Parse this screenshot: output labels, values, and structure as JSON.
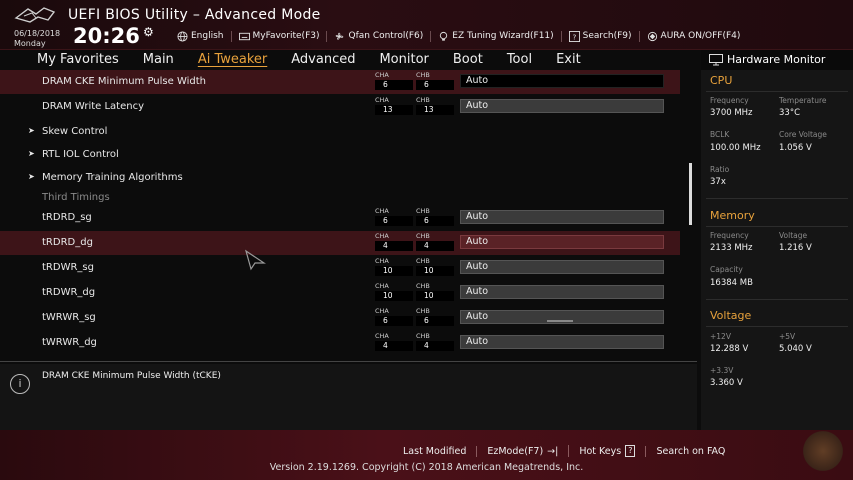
{
  "header": {
    "title": "UEFI BIOS Utility – Advanced Mode",
    "date": "06/18/2018",
    "day": "Monday",
    "time": "20:26",
    "tools": [
      {
        "label": "English",
        "icon": "globe-icon"
      },
      {
        "label": "MyFavorite(F3)",
        "icon": "keyboard-icon"
      },
      {
        "label": "Qfan Control(F6)",
        "icon": "fan-icon"
      },
      {
        "label": "EZ Tuning Wizard(F11)",
        "icon": "lightbulb-icon"
      },
      {
        "label": "Search(F9)",
        "icon": "help-icon"
      },
      {
        "label": "AURA ON/OFF(F4)",
        "icon": "aura-icon"
      }
    ]
  },
  "menu": {
    "items": [
      "My Favorites",
      "Main",
      "Ai Tweaker",
      "Advanced",
      "Monitor",
      "Boot",
      "Tool",
      "Exit"
    ],
    "active": "Ai Tweaker"
  },
  "settings": {
    "cha_label": "CHA",
    "chb_label": "CHB",
    "rows": [
      {
        "label": "DRAM CKE Minimum Pulse Width",
        "cha": "6",
        "chb": "6",
        "value": "Auto",
        "highlight": true
      },
      {
        "label": "DRAM Write Latency",
        "cha": "13",
        "chb": "13",
        "value": "Auto"
      },
      {
        "label": "Skew Control",
        "submenu": true
      },
      {
        "label": "RTL IOL Control",
        "submenu": true
      },
      {
        "label": "Memory Training Algorithms",
        "submenu": true
      },
      {
        "label": "Third Timings",
        "section": true
      },
      {
        "label": "tRDRD_sg",
        "cha": "6",
        "chb": "6",
        "value": "Auto"
      },
      {
        "label": "tRDRD_dg",
        "cha": "4",
        "chb": "4",
        "value": "Auto",
        "highlight": true
      },
      {
        "label": "tRDWR_sg",
        "cha": "10",
        "chb": "10",
        "value": "Auto"
      },
      {
        "label": "tRDWR_dg",
        "cha": "10",
        "chb": "10",
        "value": "Auto"
      },
      {
        "label": "tWRWR_sg",
        "cha": "6",
        "chb": "6",
        "value": "Auto"
      },
      {
        "label": "tWRWR_dg",
        "cha": "4",
        "chb": "4",
        "value": "Auto"
      }
    ]
  },
  "info": {
    "text": "DRAM CKE Minimum Pulse Width (tCKE)"
  },
  "hardware_monitor": {
    "title": "Hardware Monitor",
    "cpu": {
      "title": "CPU",
      "frequency_label": "Frequency",
      "frequency": "3700 MHz",
      "temperature_label": "Temperature",
      "temperature": "33°C",
      "bclk_label": "BCLK",
      "bclk": "100.00 MHz",
      "core_voltage_label": "Core Voltage",
      "core_voltage": "1.056 V",
      "ratio_label": "Ratio",
      "ratio": "37x"
    },
    "memory": {
      "title": "Memory",
      "frequency_label": "Frequency",
      "frequency": "2133 MHz",
      "voltage_label": "Voltage",
      "voltage": "1.216 V",
      "capacity_label": "Capacity",
      "capacity": "16384 MB"
    },
    "voltage": {
      "title": "Voltage",
      "v12_label": "+12V",
      "v12": "12.288 V",
      "v5_label": "+5V",
      "v5": "5.040 V",
      "v33_label": "+3.3V",
      "v33": "3.360 V"
    }
  },
  "footer": {
    "items": [
      {
        "label": "Last Modified"
      },
      {
        "label": "EzMode(F7)",
        "key": "→|"
      },
      {
        "label": "Hot Keys",
        "key": "?"
      },
      {
        "label": "Search on FAQ"
      }
    ],
    "version": "Version 2.19.1269. Copyright (C) 2018 American Megatrends, Inc."
  },
  "colors": {
    "accent": "#e8a23c",
    "highlight_row": "#3d1418",
    "brand_red": "#4a1018"
  }
}
